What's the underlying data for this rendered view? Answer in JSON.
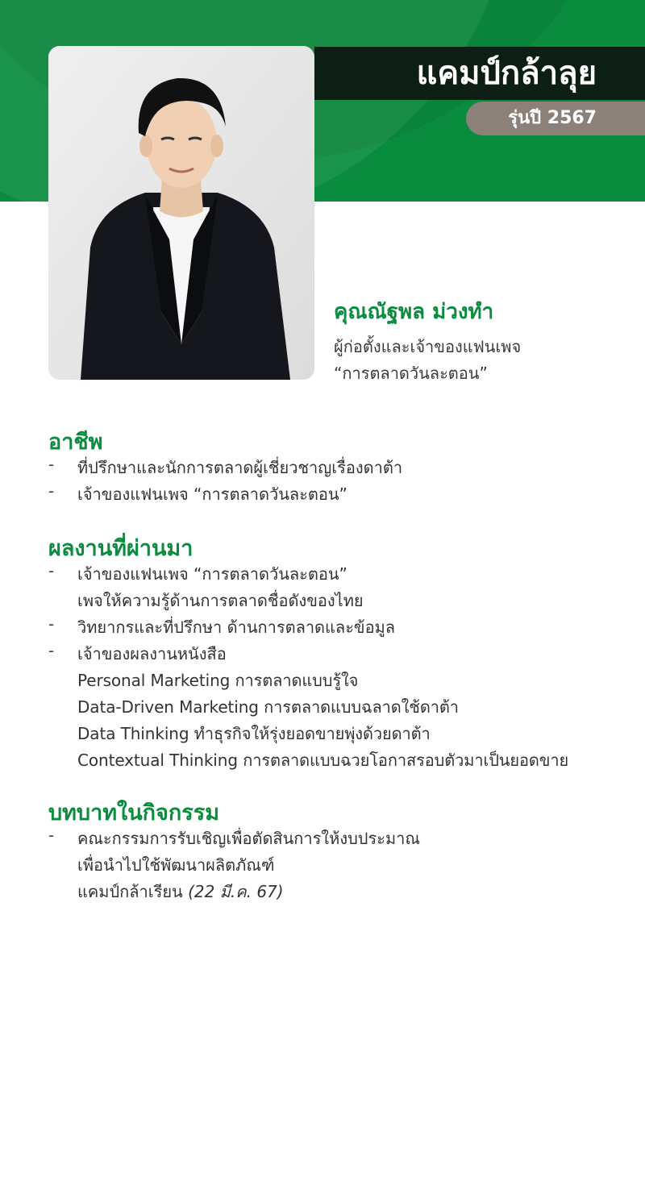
{
  "header": {
    "title": "แคมป์กล้าลุย",
    "batch": "รุ่นปี 2567"
  },
  "profile": {
    "name": "คุณณัฐพล ม่วงทำ",
    "role_lines": [
      "ผู้ก่อตั้งและเจ้าของแฟนเพจ",
      "“การตลาดวันละตอน”"
    ]
  },
  "occupation": {
    "heading": "อาชีพ",
    "items": [
      {
        "lines": [
          "ที่ปรึกษาและนักการตลาดผู้เชี่ยวชาญเรื่องดาต้า"
        ]
      },
      {
        "lines": [
          "เจ้าของแฟนเพจ “การตลาดวันละตอน”"
        ]
      }
    ]
  },
  "works": {
    "heading": "ผลงานที่ผ่านมา",
    "items": [
      {
        "lines": [
          "เจ้าของแฟนเพจ “การตลาดวันละตอน”",
          "เพจให้ความรู้ด้านการตลาดชื่อดังของไทย"
        ]
      },
      {
        "lines": [
          "วิทยากรและที่ปรึกษา ด้านการตลาดและข้อมูล"
        ]
      },
      {
        "lines": [
          "เจ้าของผลงานหนังสือ",
          "Personal Marketing การตลาดแบบรู้ใจ",
          "Data-Driven Marketing การตลาดแบบฉลาดใช้ดาต้า",
          "Data Thinking ทำธุรกิจให้รุ่งยอดขายพุ่งด้วยดาต้า",
          "Contextual Thinking การตลาดแบบฉวยโอกาสรอบตัวมาเป็นยอดขาย"
        ]
      }
    ]
  },
  "role_in_activity": {
    "heading": "บทบาทในกิจกรรม",
    "items": [
      {
        "lines": [
          "คณะกรรมการรับเชิญเพื่อตัดสินการให้งบประมาณ",
          "เพื่อนำไปใช้พัฒนาผลิตภัณฑ์"
        ],
        "last_line": "แคมป์กล้าเรียน",
        "date": "(22 มี.ค. 67)"
      }
    ]
  },
  "colors": {
    "brand_green": "#0a8c3e",
    "dark_bar": "#0d1f14",
    "pill_gray": "#8c8178"
  }
}
